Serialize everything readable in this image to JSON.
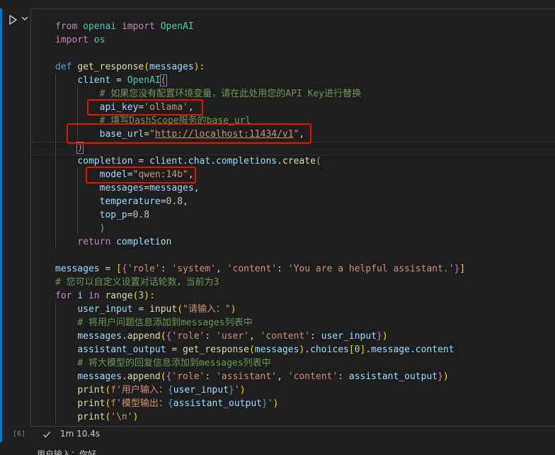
{
  "cell": {
    "exec_count": "[6]",
    "elapsed": "1m 10.4s",
    "output_first_line": "用户输入：你好"
  },
  "colors": {
    "accent": "#0078d4",
    "highlight_box": "#e51400",
    "success": "#89d185"
  },
  "icons": {
    "run": "play-icon",
    "more": "chevron-down-icon",
    "status": "check-icon"
  },
  "code": {
    "l1": {
      "from": "from",
      "mod": "openai",
      "imp": "import",
      "cls": "OpenAI"
    },
    "l2": {
      "imp": "import",
      "mod": "os"
    },
    "l4": {
      "def": "def",
      "fn": "get_response",
      "p1": "(",
      "param": "messages",
      "p2": "):"
    },
    "l5": {
      "var": "client",
      "eq": " = ",
      "cls": "OpenAI",
      "p": "("
    },
    "l6": "# 如果您没有配置环境变量，请在此处用您的API Key进行替换",
    "l7": {
      "var": "api_key",
      "eq": "=",
      "str": "'ollama'",
      "comma": ","
    },
    "l8": "# 填写DashScope服务的base_url",
    "l9": {
      "var": "base_url",
      "eq": "=",
      "q1": "\"",
      "url": "http://localhost:11434/v1",
      "q2": "\"",
      "comma": ","
    },
    "l10": ")",
    "l11": {
      "var": "completion",
      "eq": " = ",
      "obj": "client",
      "d1": ".",
      "a1": "chat",
      "d2": ".",
      "a2": "completions",
      "d3": ".",
      "fn": "create",
      "p": "("
    },
    "l12": {
      "var": "model",
      "eq": "=",
      "str": "\"qwen:14b\"",
      "comma": ","
    },
    "l13": {
      "var": "messages",
      "eq": "=",
      "val": "messages",
      "comma": ","
    },
    "l14": {
      "var": "temperature",
      "eq": "=",
      "num": "0.8",
      "comma": ","
    },
    "l15": {
      "var": "top_p",
      "eq": "=",
      "num": "0.8"
    },
    "l16": ")",
    "l17": {
      "kw": "return",
      "var": "completion"
    },
    "l19": {
      "var": "messages",
      "eq": " = ",
      "b1": "[",
      "c1": "{",
      "s1": "'role'",
      "col1": ": ",
      "s2": "'system'",
      "sep": ", ",
      "s3": "'content'",
      "col2": ": ",
      "s4": "'You are a helpful assistant.'",
      "c2": "}",
      "b2": "]"
    },
    "l20": "# 您可以自定义设置对话轮数，当前为3",
    "l21": {
      "kw": "for",
      "var": "i",
      "in": "in",
      "fn": "range",
      "p1": "(",
      "num": "3",
      "p2": "):"
    },
    "l22": {
      "var": "user_input",
      "eq": " = ",
      "fn": "input",
      "p1": "(",
      "str": "\"请输入：\"",
      "p2": ")"
    },
    "l23": "# 将用户问题信息添加到messages列表中",
    "l24": {
      "var": "messages",
      "d": ".",
      "fn": "append",
      "p1": "(",
      "c1": "{",
      "s1": "'role'",
      "col1": ": ",
      "s2": "'user'",
      "sep": ", ",
      "s3": "'content'",
      "col2": ": ",
      "v": "user_input",
      "c2": "}",
      "p2": ")"
    },
    "l25": {
      "var": "assistant_output",
      "eq": " = ",
      "fn": "get_response",
      "p1": "(",
      "arg": "messages",
      "p2": ")",
      "d1": ".",
      "a1": "choices",
      "b1": "[",
      "num": "0",
      "b2": "]",
      "d2": ".",
      "a2": "message",
      "d3": ".",
      "a3": "content"
    },
    "l26": "# 将大模型的回复信息添加到messages列表中",
    "l27": {
      "var": "messages",
      "d": ".",
      "fn": "append",
      "p1": "(",
      "c1": "{",
      "s1": "'role'",
      "col1": ": ",
      "s2": "'assistant'",
      "sep": ", ",
      "s3": "'content'",
      "col2": ": ",
      "v": "assistant_output",
      "c2": "}",
      "p2": ")"
    },
    "l28": {
      "fn": "print",
      "p1": "(",
      "pre": "f'用户输入：",
      "lb": "{",
      "v": "user_input",
      "rb": "}",
      "post": "'",
      "p2": ")"
    },
    "l29": {
      "fn": "print",
      "p1": "(",
      "pre": "f'模型输出：",
      "lb": "{",
      "v": "assistant_output",
      "rb": "}",
      "post": "'",
      "p2": ")"
    },
    "l30": {
      "fn": "print",
      "p1": "(",
      "str": "'\\n'",
      "p2": ")"
    }
  }
}
